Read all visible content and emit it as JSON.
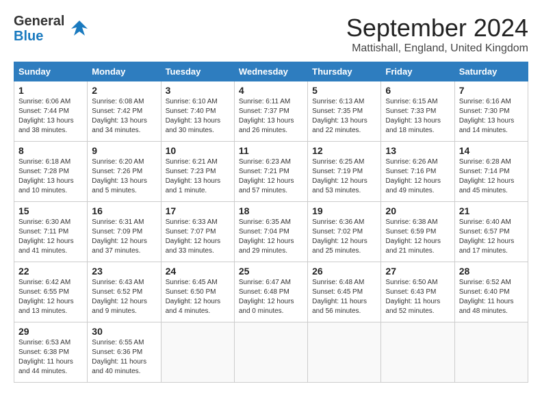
{
  "header": {
    "logo_line1": "General",
    "logo_line2": "Blue",
    "month": "September 2024",
    "location": "Mattishall, England, United Kingdom"
  },
  "days_of_week": [
    "Sunday",
    "Monday",
    "Tuesday",
    "Wednesday",
    "Thursday",
    "Friday",
    "Saturday"
  ],
  "weeks": [
    [
      {
        "day": "1",
        "info": "Sunrise: 6:06 AM\nSunset: 7:44 PM\nDaylight: 13 hours\nand 38 minutes."
      },
      {
        "day": "2",
        "info": "Sunrise: 6:08 AM\nSunset: 7:42 PM\nDaylight: 13 hours\nand 34 minutes."
      },
      {
        "day": "3",
        "info": "Sunrise: 6:10 AM\nSunset: 7:40 PM\nDaylight: 13 hours\nand 30 minutes."
      },
      {
        "day": "4",
        "info": "Sunrise: 6:11 AM\nSunset: 7:37 PM\nDaylight: 13 hours\nand 26 minutes."
      },
      {
        "day": "5",
        "info": "Sunrise: 6:13 AM\nSunset: 7:35 PM\nDaylight: 13 hours\nand 22 minutes."
      },
      {
        "day": "6",
        "info": "Sunrise: 6:15 AM\nSunset: 7:33 PM\nDaylight: 13 hours\nand 18 minutes."
      },
      {
        "day": "7",
        "info": "Sunrise: 6:16 AM\nSunset: 7:30 PM\nDaylight: 13 hours\nand 14 minutes."
      }
    ],
    [
      {
        "day": "8",
        "info": "Sunrise: 6:18 AM\nSunset: 7:28 PM\nDaylight: 13 hours\nand 10 minutes."
      },
      {
        "day": "9",
        "info": "Sunrise: 6:20 AM\nSunset: 7:26 PM\nDaylight: 13 hours\nand 5 minutes."
      },
      {
        "day": "10",
        "info": "Sunrise: 6:21 AM\nSunset: 7:23 PM\nDaylight: 13 hours\nand 1 minute."
      },
      {
        "day": "11",
        "info": "Sunrise: 6:23 AM\nSunset: 7:21 PM\nDaylight: 12 hours\nand 57 minutes."
      },
      {
        "day": "12",
        "info": "Sunrise: 6:25 AM\nSunset: 7:19 PM\nDaylight: 12 hours\nand 53 minutes."
      },
      {
        "day": "13",
        "info": "Sunrise: 6:26 AM\nSunset: 7:16 PM\nDaylight: 12 hours\nand 49 minutes."
      },
      {
        "day": "14",
        "info": "Sunrise: 6:28 AM\nSunset: 7:14 PM\nDaylight: 12 hours\nand 45 minutes."
      }
    ],
    [
      {
        "day": "15",
        "info": "Sunrise: 6:30 AM\nSunset: 7:11 PM\nDaylight: 12 hours\nand 41 minutes."
      },
      {
        "day": "16",
        "info": "Sunrise: 6:31 AM\nSunset: 7:09 PM\nDaylight: 12 hours\nand 37 minutes."
      },
      {
        "day": "17",
        "info": "Sunrise: 6:33 AM\nSunset: 7:07 PM\nDaylight: 12 hours\nand 33 minutes."
      },
      {
        "day": "18",
        "info": "Sunrise: 6:35 AM\nSunset: 7:04 PM\nDaylight: 12 hours\nand 29 minutes."
      },
      {
        "day": "19",
        "info": "Sunrise: 6:36 AM\nSunset: 7:02 PM\nDaylight: 12 hours\nand 25 minutes."
      },
      {
        "day": "20",
        "info": "Sunrise: 6:38 AM\nSunset: 6:59 PM\nDaylight: 12 hours\nand 21 minutes."
      },
      {
        "day": "21",
        "info": "Sunrise: 6:40 AM\nSunset: 6:57 PM\nDaylight: 12 hours\nand 17 minutes."
      }
    ],
    [
      {
        "day": "22",
        "info": "Sunrise: 6:42 AM\nSunset: 6:55 PM\nDaylight: 12 hours\nand 13 minutes."
      },
      {
        "day": "23",
        "info": "Sunrise: 6:43 AM\nSunset: 6:52 PM\nDaylight: 12 hours\nand 9 minutes."
      },
      {
        "day": "24",
        "info": "Sunrise: 6:45 AM\nSunset: 6:50 PM\nDaylight: 12 hours\nand 4 minutes."
      },
      {
        "day": "25",
        "info": "Sunrise: 6:47 AM\nSunset: 6:48 PM\nDaylight: 12 hours\nand 0 minutes."
      },
      {
        "day": "26",
        "info": "Sunrise: 6:48 AM\nSunset: 6:45 PM\nDaylight: 11 hours\nand 56 minutes."
      },
      {
        "day": "27",
        "info": "Sunrise: 6:50 AM\nSunset: 6:43 PM\nDaylight: 11 hours\nand 52 minutes."
      },
      {
        "day": "28",
        "info": "Sunrise: 6:52 AM\nSunset: 6:40 PM\nDaylight: 11 hours\nand 48 minutes."
      }
    ],
    [
      {
        "day": "29",
        "info": "Sunrise: 6:53 AM\nSunset: 6:38 PM\nDaylight: 11 hours\nand 44 minutes."
      },
      {
        "day": "30",
        "info": "Sunrise: 6:55 AM\nSunset: 6:36 PM\nDaylight: 11 hours\nand 40 minutes."
      },
      {
        "day": "",
        "info": ""
      },
      {
        "day": "",
        "info": ""
      },
      {
        "day": "",
        "info": ""
      },
      {
        "day": "",
        "info": ""
      },
      {
        "day": "",
        "info": ""
      }
    ]
  ]
}
